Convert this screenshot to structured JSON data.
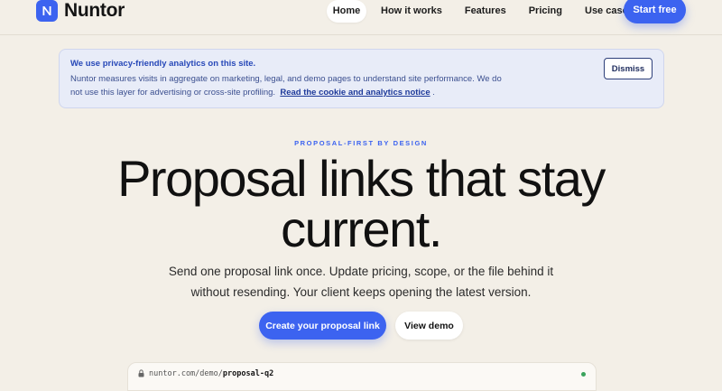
{
  "brand": {
    "name": "Nuntor",
    "accent": "#3c63f0"
  },
  "nav": {
    "items": [
      {
        "label": "Home",
        "active": true
      },
      {
        "label": "How it works"
      },
      {
        "label": "Features"
      },
      {
        "label": "Pricing"
      },
      {
        "label": "Use cases"
      }
    ],
    "cta": "Start free"
  },
  "banner": {
    "title": "We use privacy-friendly analytics on this site.",
    "body": "Nuntor measures visits in aggregate on marketing, legal, and demo pages to understand site performance. We do not use this layer for advertising or cross-site profiling.",
    "link": "Read the cookie and analytics notice",
    "suffix": ".",
    "dismiss": "Dismiss"
  },
  "hero": {
    "eyebrow": "PROPOSAL-FIRST BY DESIGN",
    "headline_line1": "Proposal links that stay",
    "headline_line2": "current.",
    "sub_line1": "Send one proposal link once. Update pricing, scope, or the file behind it",
    "sub_line2": "without resending. Your client keeps opening the latest version.",
    "primary_cta": "Create your proposal link",
    "secondary_cta": "View demo"
  },
  "preview": {
    "url_host": "nuntor.com/demo/",
    "url_path": "proposal-q2",
    "status_color": "#3aa35c"
  }
}
